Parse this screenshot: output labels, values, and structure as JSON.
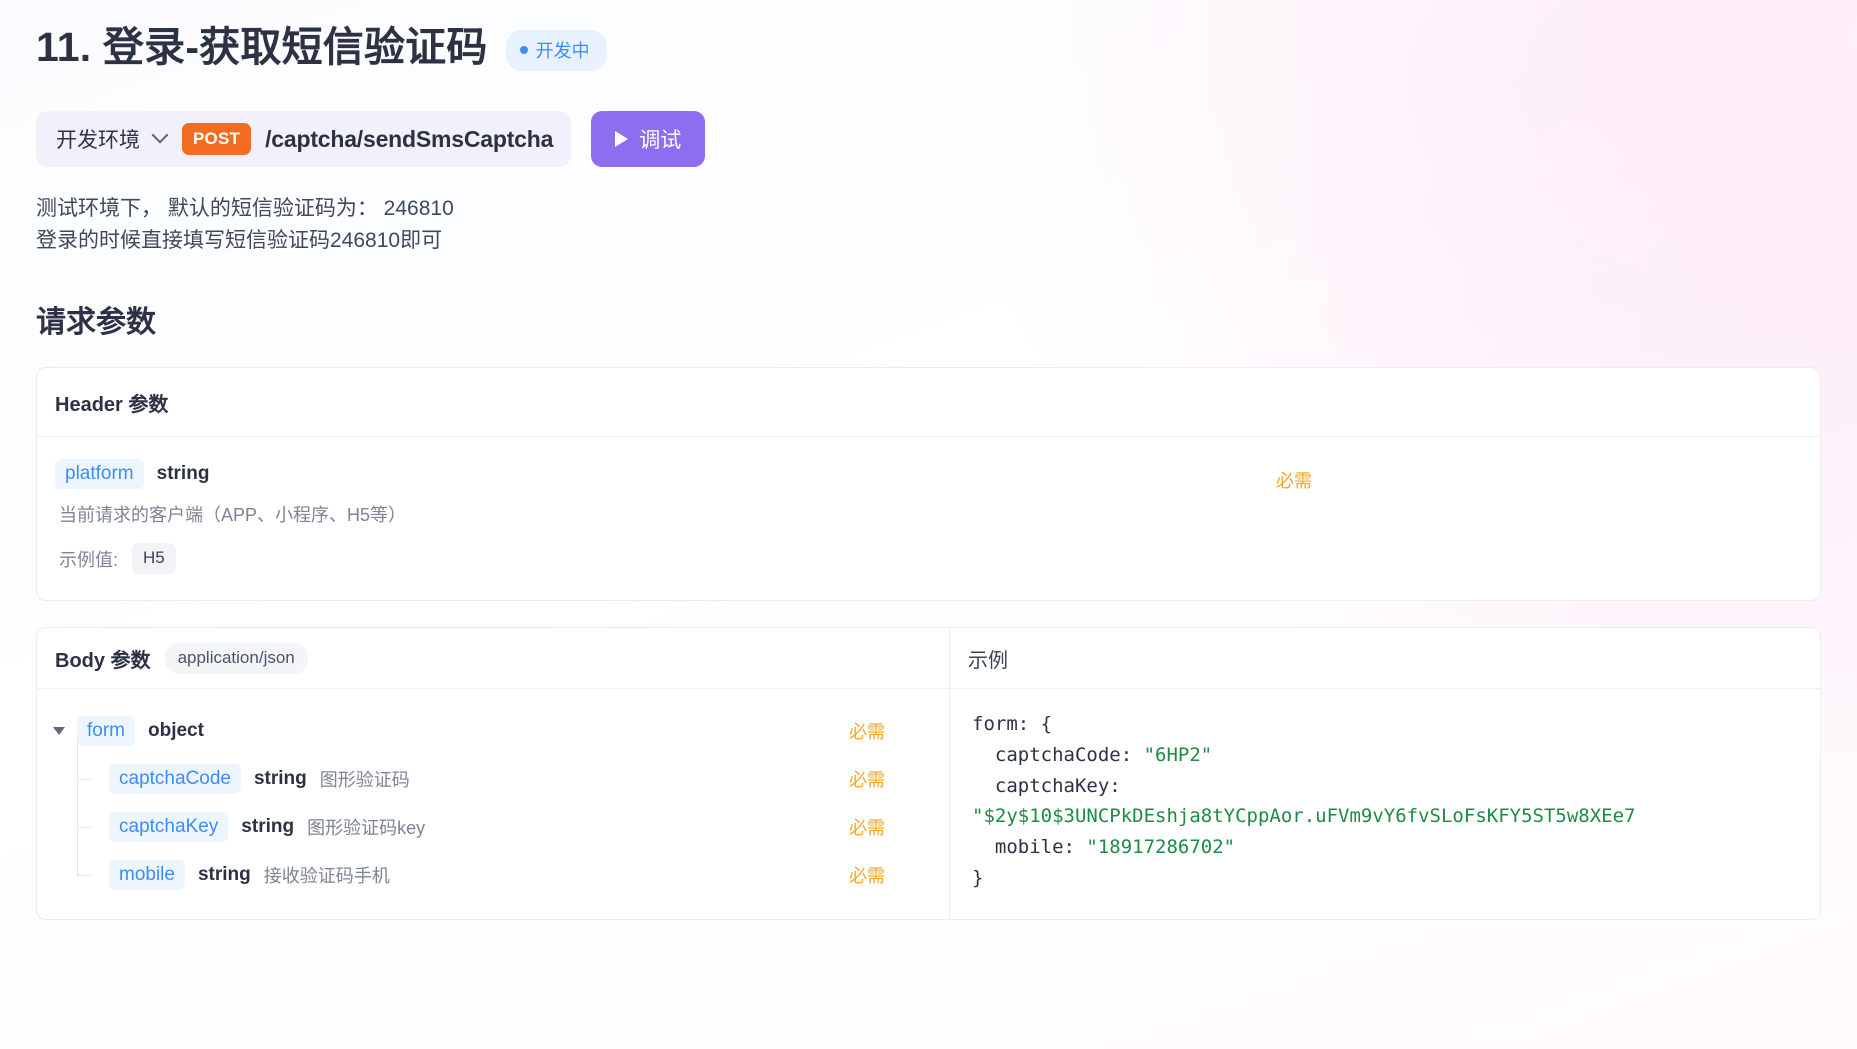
{
  "header": {
    "title": "11. 登录-获取短信验证码",
    "status_label": "开发中",
    "status_color": "#3f8cf6"
  },
  "toolbar": {
    "environment": "开发环境",
    "method": "POST",
    "method_color": "#f26d21",
    "path": "/captcha/sendSmsCaptcha",
    "debug_label": "调试",
    "debug_color": "#8d6ef0"
  },
  "description": {
    "line1": "测试环境下， 默认的短信验证码为： 246810",
    "line2": "登录的时候直接填写短信验证码246810即可"
  },
  "request_section": {
    "heading": "请求参数"
  },
  "header_params": {
    "card_title": "Header 参数",
    "required_label": "必需",
    "example_label": "示例值:",
    "rows": [
      {
        "name": "platform",
        "type": "string",
        "description": "当前请求的客户端（APP、小程序、H5等）",
        "example": "H5",
        "required": "必需"
      }
    ]
  },
  "body_params": {
    "card_title": "Body 参数",
    "mime": "application/json",
    "rows": [
      {
        "name": "form",
        "type": "object",
        "description": "",
        "required": "必需"
      },
      {
        "name": "captchaCode",
        "type": "string",
        "description": "图形验证码",
        "required": "必需"
      },
      {
        "name": "captchaKey",
        "type": "string",
        "description": "图形验证码key",
        "required": "必需"
      },
      {
        "name": "mobile",
        "type": "string",
        "description": "接收验证码手机",
        "required": "必需"
      }
    ]
  },
  "example_panel": {
    "title": "示例",
    "line_open": "form: {",
    "key_captchacode": "  captchaCode: ",
    "val_captchacode": "\"6HP2\"",
    "key_captchakey": "  captchaKey:",
    "val_captchakey": "\"$2y$10$3UNCPkDEshja8tYCppAor.uFVm9vY6fvSLoFsKFY5ST5w8XEe7",
    "key_mobile": "  mobile: ",
    "val_mobile": "\"18917286702\"",
    "line_close": "}"
  }
}
